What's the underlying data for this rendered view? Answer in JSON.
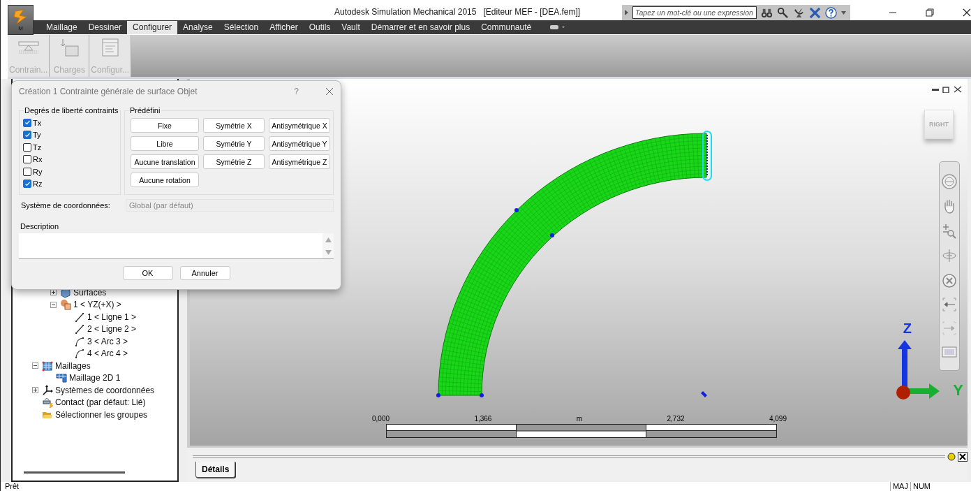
{
  "window": {
    "title": "Autodesk Simulation Mechanical 2015   [Editeur MEF - [DEA.fem]]",
    "app_button_label": "M"
  },
  "search": {
    "placeholder": "Tapez un mot-clé ou une expression"
  },
  "menu": [
    {
      "label": "Maillage",
      "selected": false
    },
    {
      "label": "Dessiner",
      "selected": false
    },
    {
      "label": "Configurer",
      "selected": true
    },
    {
      "label": "Analyse",
      "selected": false
    },
    {
      "label": "Sélection",
      "selected": false
    },
    {
      "label": "Afficher",
      "selected": false
    },
    {
      "label": "Outils",
      "selected": false
    },
    {
      "label": "Vault",
      "selected": false
    },
    {
      "label": "Démarrer et en savoir plus",
      "selected": false
    },
    {
      "label": "Communauté",
      "selected": false
    }
  ],
  "ribbon": [
    {
      "label": "Contrain...",
      "kind": "constraint",
      "disabled": true
    },
    {
      "label": "Charges",
      "kind": "load",
      "disabled": true
    },
    {
      "label": "Configur...",
      "kind": "setup",
      "disabled": true
    }
  ],
  "dialog": {
    "title": "Création 1 Contrainte générale de surface Objet",
    "help": "?",
    "dof_group": "Degrés de liberté contraints",
    "dof": [
      {
        "label": "Tx",
        "checked": true
      },
      {
        "label": "Ty",
        "checked": true
      },
      {
        "label": "Tz",
        "checked": false
      },
      {
        "label": "Rx",
        "checked": false
      },
      {
        "label": "Ry",
        "checked": false
      },
      {
        "label": "Rz",
        "checked": true
      }
    ],
    "preset_group": "Prédéfini",
    "presets": [
      "Fixe",
      "Symétrie X",
      "Antisymétrique X",
      "Libre",
      "Symétrie Y",
      "Antisymétrique Y",
      "Aucune translation",
      "Symétrie Z",
      "Antisymétrique Z",
      "Aucune rotation"
    ],
    "coord_label": "Système de coordonnées:",
    "coord_value": "Global (par défaut)",
    "coord_disabled": true,
    "description_label": "Description",
    "buttons": [
      "OK",
      "Annuler"
    ]
  },
  "tree": {
    "partial_items": [
      {
        "label": "Surfaces",
        "kind": "surface",
        "expanded": false
      },
      {
        "label": "1 < YZ(+X) >",
        "kind": "part",
        "expanded": true,
        "children": [
          {
            "label": "1 < Ligne 1 >",
            "kind": "line"
          },
          {
            "label": "2 < Ligne 2 >",
            "kind": "line"
          },
          {
            "label": "3 < Arc 3 >",
            "kind": "arc"
          },
          {
            "label": "4 < Arc 4 >",
            "kind": "arc"
          }
        ]
      }
    ],
    "items": [
      {
        "label": "Maillages",
        "kind": "mesh",
        "expanded": true,
        "children": [
          {
            "label": "Maillage 2D 1",
            "kind": "mesh2d"
          }
        ]
      },
      {
        "label": "Systèmes de coordonnées",
        "kind": "axes",
        "expanded": false
      },
      {
        "label": "Contact (par défaut: Lié)",
        "kind": "contact"
      },
      {
        "label": "Sélectionner les groupes",
        "kind": "folder"
      }
    ]
  },
  "viewport": {
    "view_cube": "RIGHT",
    "axes": [
      "Z",
      "Y"
    ],
    "scale_bar": {
      "labels": [
        "0,000",
        "1,366",
        "2,732",
        "4,099"
      ],
      "unit": "m"
    }
  },
  "bottom_panel": {
    "tabs": [
      {
        "label": "Détails",
        "selected": true
      }
    ]
  },
  "status_bar": {
    "message": "Prêt",
    "indicators": [
      "MAJ",
      "NUM"
    ]
  }
}
